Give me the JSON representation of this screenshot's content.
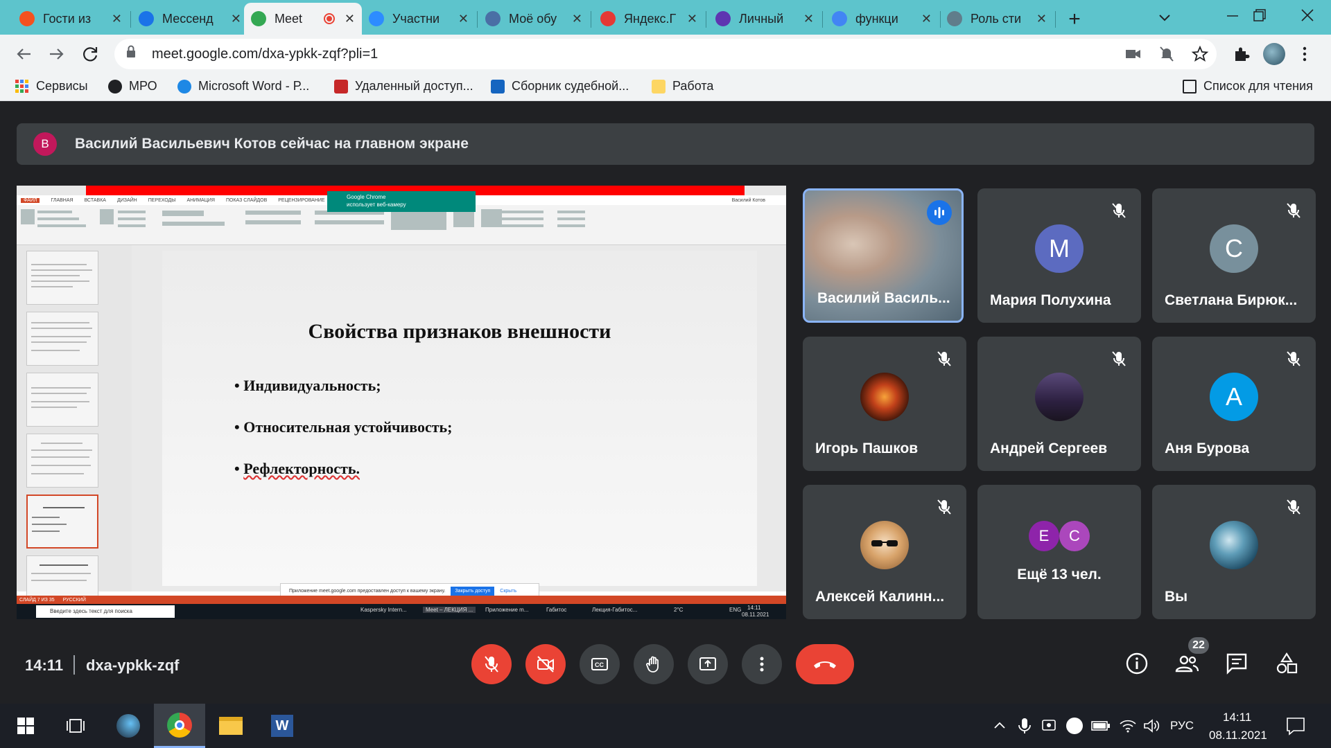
{
  "browser": {
    "tabs": [
      {
        "label": "Гости из",
        "color": "#f4511e"
      },
      {
        "label": "Мессенд",
        "color": "#1a73e8"
      },
      {
        "label": "Meet",
        "color": "#34a853"
      },
      {
        "label": "Участни",
        "color": "#2d8cff"
      },
      {
        "label": "Моё обу",
        "color": "#4a6fa5"
      },
      {
        "label": "Яндекс.Г",
        "color": "#e53935"
      },
      {
        "label": "Личный",
        "color": "#5e35b1"
      },
      {
        "label": "функци",
        "color": "#4285f4"
      },
      {
        "label": "Роль сти",
        "color": "#607d8b"
      }
    ],
    "url": "meet.google.com/dxa-ypkk-zqf?pli=1",
    "bookmarks": [
      {
        "label": "Сервисы"
      },
      {
        "label": "МРО"
      },
      {
        "label": "Microsoft Word - Р..."
      },
      {
        "label": "Удаленный доступ..."
      },
      {
        "label": "Сборник судебной..."
      },
      {
        "label": "Работа"
      }
    ],
    "reading_list": "Список для чтения"
  },
  "meet": {
    "banner_initial": "В",
    "banner_text": "Василий Васильевич Котов сейчас на главном экране",
    "participants": [
      {
        "name": "Василий Василь...",
        "type": "video",
        "speaking": true
      },
      {
        "name": "Мария Полухина",
        "initial": "М",
        "color": "#5c6bc0"
      },
      {
        "name": "Светлана Бирюк...",
        "initial": "С",
        "color": "#78909c"
      },
      {
        "name": "Игорь Пашков",
        "type": "image"
      },
      {
        "name": "Андрей Сергеев",
        "type": "image"
      },
      {
        "name": "Аня Бурова",
        "initial": "А",
        "color": "#039be5"
      },
      {
        "name": "Алексей Калинн...",
        "type": "image"
      },
      {
        "name": "Ещё 13 чел.",
        "type": "more",
        "initials": [
          "Е",
          "С"
        ],
        "colors": [
          "#8e24aa",
          "#ab47bc"
        ]
      },
      {
        "name": "Вы",
        "type": "image"
      }
    ],
    "time": "14:11",
    "meeting_code": "dxa-ypkk-zqf",
    "participants_count": "22"
  },
  "shared_screen": {
    "slide_title": "Свойства признаков внешности",
    "bullets": [
      "Индивидуальность;",
      "Относительная устойчивость;",
      "Рефлекторность."
    ],
    "notification_title": "Google Chrome",
    "notification_text": "использует веб-камеру",
    "share_bar_text": "Приложение meet.google.com предоставлен доступ к вашему экрану.",
    "share_stop": "Закрыть доступ",
    "share_hide": "Скрыть",
    "search_placeholder": "Введите здесь текст для поиска",
    "status_left": "СЛАЙД 7 ИЗ 35",
    "lang": "РУССКИЙ",
    "ribbon_tabs": [
      "ФАЙЛ",
      "ГЛАВНАЯ",
      "ВСТАВКА",
      "ДИЗАЙН",
      "ПЕРЕХОДЫ",
      "АНИМАЦИЯ",
      "ПОКАЗ СЛАЙДОВ",
      "РЕЦЕНЗИРОВАНИЕ"
    ],
    "user": "Василий Котов",
    "taskbar_items": [
      "Kaspersky Intern...",
      "Meet – ЛЕКЦИЯ ...",
      "Приложение m...",
      "Габитос",
      "Лекция-Габитос..."
    ],
    "clock_time": "14:11",
    "clock_date": "08.11.2021",
    "temp": "2°C",
    "kb": "ENG"
  },
  "taskbar": {
    "lang": "РУС",
    "time": "14:11",
    "date": "08.11.2021"
  }
}
